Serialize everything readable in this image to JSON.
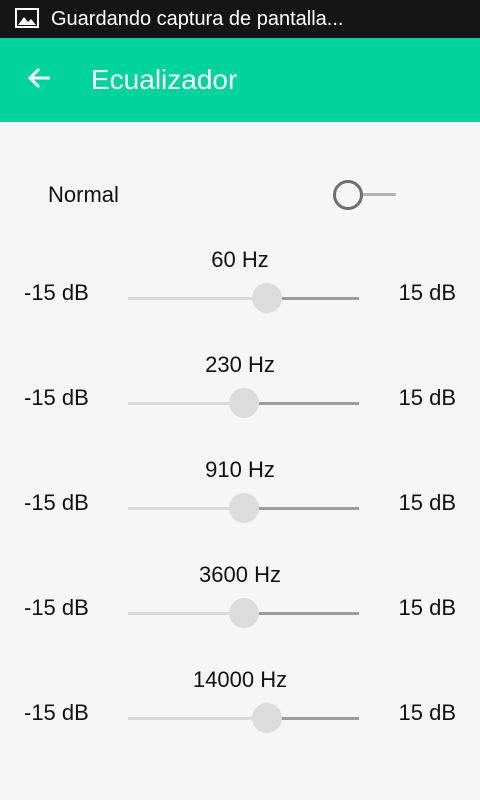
{
  "status_bar": {
    "notification_icon": "image-icon",
    "text": "Guardando captura de pantalla..."
  },
  "app_bar": {
    "back_icon": "arrow-left-icon",
    "title": "Ecualizador",
    "color": "#00d39b"
  },
  "preset": {
    "label": "Normal",
    "switch_on": false
  },
  "bands": [
    {
      "freq": "60 Hz",
      "min": "-15 dB",
      "max": "15 dB",
      "level_fraction": 0.6
    },
    {
      "freq": "230 Hz",
      "min": "-15 dB",
      "max": "15 dB",
      "level_fraction": 0.5
    },
    {
      "freq": "910 Hz",
      "min": "-15 dB",
      "max": "15 dB",
      "level_fraction": 0.5
    },
    {
      "freq": "3600 Hz",
      "min": "-15 dB",
      "max": "15 dB",
      "level_fraction": 0.5
    },
    {
      "freq": "14000 Hz",
      "min": "-15 dB",
      "max": "15 dB",
      "level_fraction": 0.6
    }
  ]
}
